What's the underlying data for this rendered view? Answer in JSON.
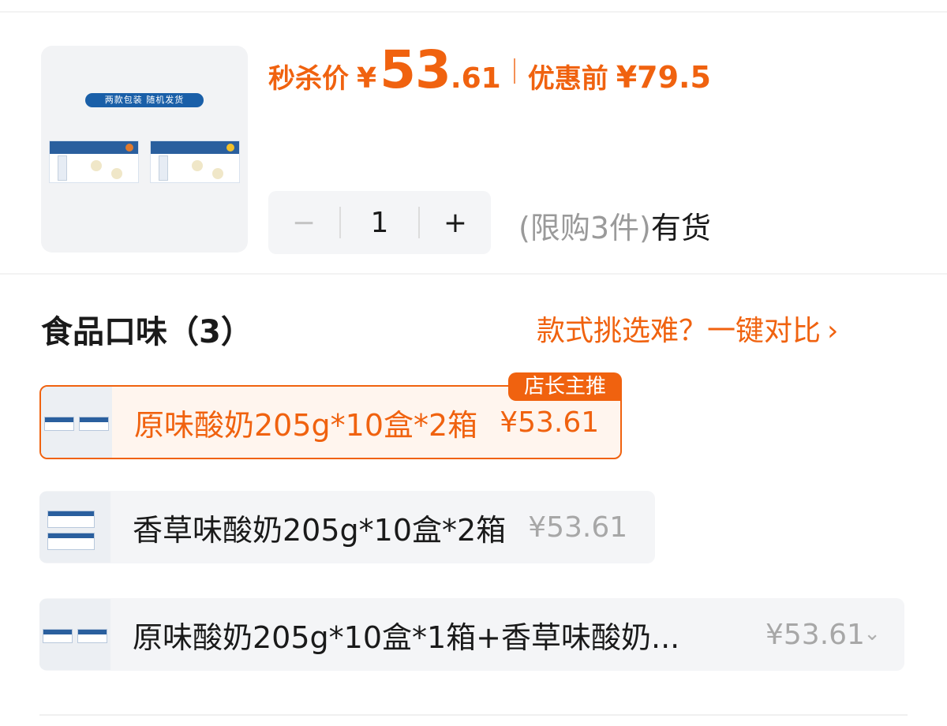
{
  "product": {
    "image_banner": "两款包装 随机发货",
    "flash_label": "秒杀价",
    "currency": "¥",
    "price_int": "53",
    "price_dec": ".61",
    "orig_label": "优惠前",
    "orig_price": "¥79.5"
  },
  "quantity": {
    "minus": "−",
    "value": "1",
    "plus": "+",
    "limit_text": "(限购3件)",
    "stock_text": "有货"
  },
  "section": {
    "title": "食品口味（3）",
    "compare_link": "款式挑选难？一键对比",
    "compare_chevron": "›"
  },
  "options": [
    {
      "name": "原味酸奶205g*10盒*2箱",
      "price": "¥53.61",
      "badge": "店长主推",
      "selected": true
    },
    {
      "name": "香草味酸奶205g*10盒*2箱",
      "price": "¥53.61",
      "selected": false
    },
    {
      "name": "原味酸奶205g*10盒*1箱+香草味酸奶...",
      "price": "¥53.61",
      "chevron": "⌄",
      "selected": false
    }
  ],
  "colors": {
    "accent": "#f0620f",
    "muted_text": "#a7a7a7",
    "option_bg": "#f4f5f7",
    "selected_bg": "#fff5ee"
  }
}
